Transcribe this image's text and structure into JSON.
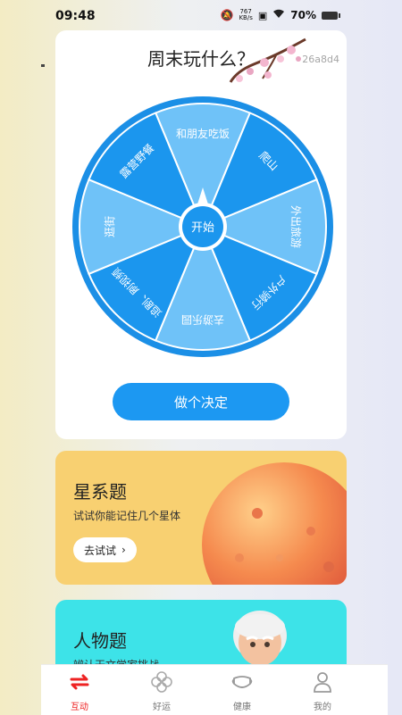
{
  "status": {
    "time": "09:48",
    "net_speed_value": "767",
    "net_speed_unit": "KB/s",
    "battery": "70%"
  },
  "wheel_card": {
    "title": "周末玩什么？",
    "hash": "26a8d4",
    "center_label": "开始",
    "segments": [
      "和朋友吃饭",
      "爬山",
      "外出旅游",
      "户外骑行",
      "去游乐园",
      "追剧、刷视频",
      "逛街",
      "露营野餐"
    ],
    "decide_button": "做个决定",
    "colors": {
      "light": "#6fc2f8",
      "dark": "#1b96ee",
      "rim": "#1b8fe6"
    }
  },
  "star_quiz": {
    "title": "星系题",
    "desc": "试试你能记住几个星体",
    "button": "去试试"
  },
  "people_quiz": {
    "title": "人物题",
    "desc": "辨认天文学家挑战"
  },
  "nav": {
    "items": [
      {
        "label": "互动",
        "active": true
      },
      {
        "label": "好运",
        "active": false
      },
      {
        "label": "健康",
        "active": false
      },
      {
        "label": "我的",
        "active": false
      }
    ]
  }
}
